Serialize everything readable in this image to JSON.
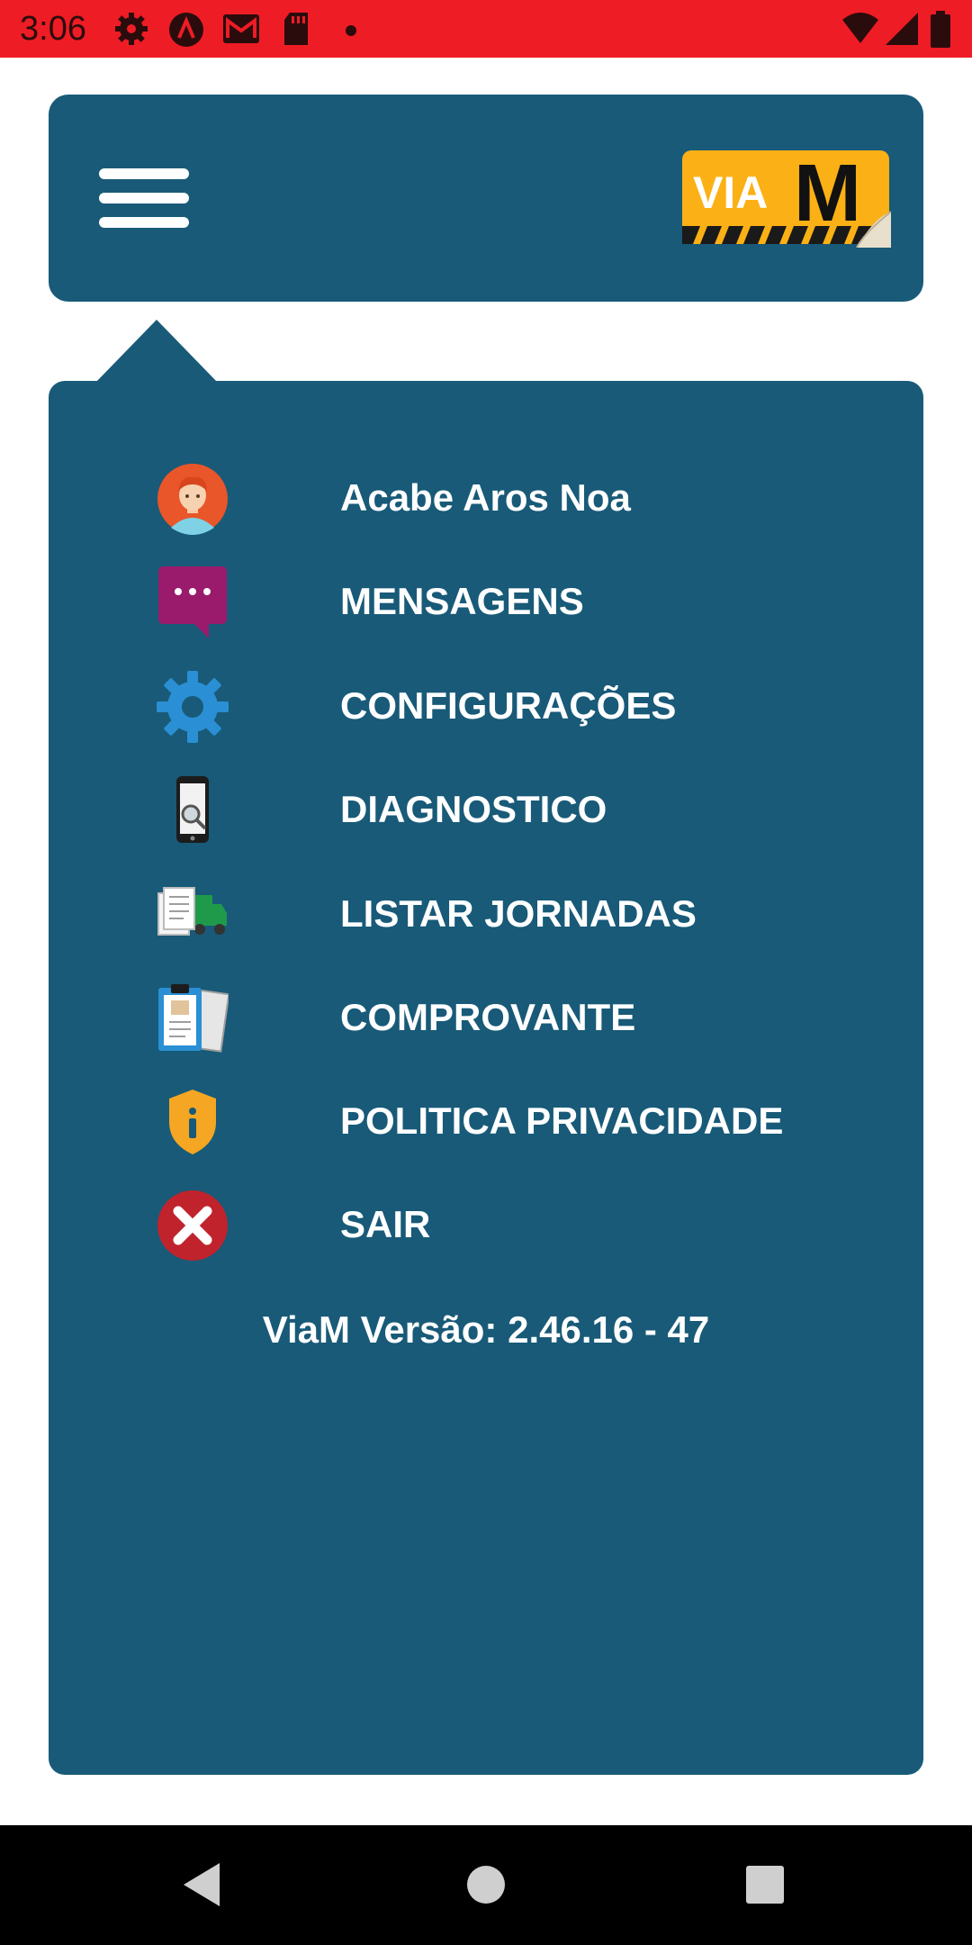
{
  "status_bar": {
    "time": "3:06",
    "icons_left": [
      "settings-icon",
      "alert-icon",
      "gmail-icon",
      "sd-card-icon",
      "notification-dot"
    ],
    "icons_right": [
      "wifi-icon",
      "cell-signal-icon",
      "battery-icon"
    ],
    "background": "#ee1c25"
  },
  "header": {
    "menu_icon": "hamburger-menu-icon",
    "logo_text_via": "VIA",
    "logo_text_m": "M",
    "background": "#185a78"
  },
  "menu": {
    "items": [
      {
        "label": "Acabe Aros Noa",
        "icon": "user-avatar-icon"
      },
      {
        "label": "MENSAGENS",
        "icon": "chat-bubble-icon"
      },
      {
        "label": "CONFIGURAÇÕES",
        "icon": "gear-icon"
      },
      {
        "label": "DIAGNOSTICO",
        "icon": "phone-search-icon"
      },
      {
        "label": "LISTAR JORNADAS",
        "icon": "truck-documents-icon"
      },
      {
        "label": "COMPROVANTE",
        "icon": "clipboard-icon"
      },
      {
        "label": "POLITICA PRIVACIDADE",
        "icon": "shield-info-icon"
      },
      {
        "label": "SAIR",
        "icon": "exit-x-icon"
      }
    ],
    "version": "ViaM Versão: 2.46.16 - 47",
    "background": "#185a78"
  },
  "nav_bar": {
    "buttons": [
      "back-icon",
      "home-icon",
      "recents-icon"
    ]
  }
}
